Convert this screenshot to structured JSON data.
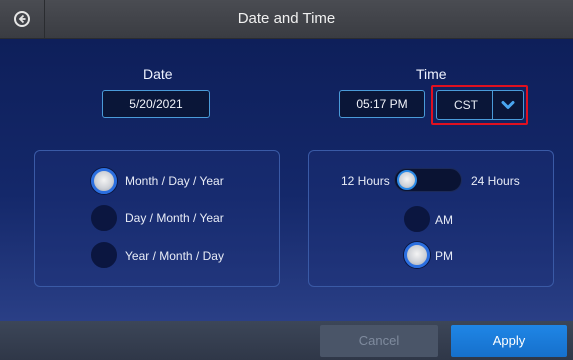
{
  "header": {
    "title": "Date and Time",
    "back_icon": "back-arrow-icon"
  },
  "date": {
    "label": "Date",
    "value": "5/20/2021"
  },
  "time": {
    "label": "Time",
    "value": "05:17 PM",
    "timezone": "CST",
    "caret_icon": "chevron-down-icon"
  },
  "date_format": {
    "options": [
      "Month / Day / Year",
      "Day / Month / Year",
      "Year / Month / Day"
    ],
    "selected": "Month / Day / Year"
  },
  "time_format": {
    "left_label": "12 Hours",
    "right_label": "24 Hours",
    "selected": "12 Hours",
    "ampm": [
      "AM",
      "PM"
    ],
    "ampm_selected": "PM"
  },
  "footer": {
    "cancel_label": "Cancel",
    "apply_label": "Apply"
  },
  "colors": {
    "accent": "#1f86e6",
    "highlight": "#e01020",
    "background": "#14286a"
  }
}
